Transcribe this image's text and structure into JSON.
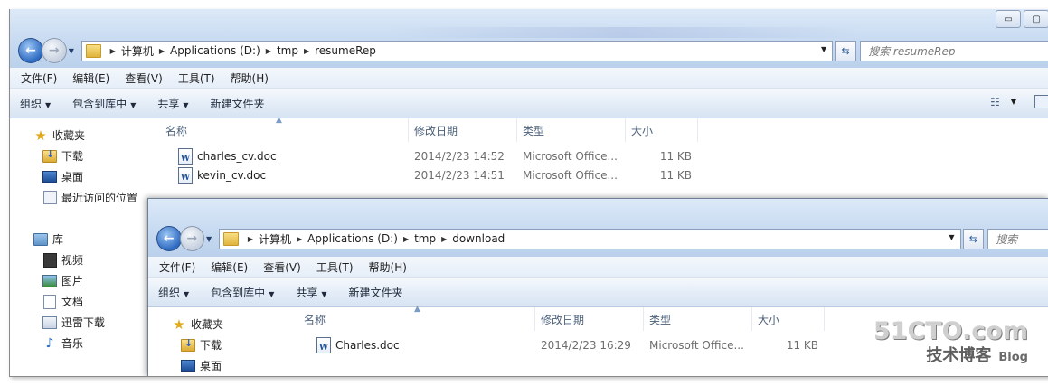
{
  "window1": {
    "caption_buttons": [
      "▭",
      "▢"
    ],
    "address": {
      "segments": [
        "计算机",
        "Applications (D:)",
        "tmp",
        "resumeRep"
      ]
    },
    "search_placeholder": "搜索 resumeRep",
    "menu": [
      "文件(F)",
      "编辑(E)",
      "查看(V)",
      "工具(T)",
      "帮助(H)"
    ],
    "commands": {
      "organize": "组织",
      "include_library": "包含到库中",
      "share": "共享",
      "new_folder": "新建文件夹"
    },
    "nav": {
      "favorites": "收藏夹",
      "downloads": "下载",
      "desktop": "桌面",
      "recent": "最近访问的位置",
      "libraries": "库",
      "videos": "视频",
      "pictures": "图片",
      "documents": "文档",
      "thunder": "迅雷下载",
      "music": "音乐"
    },
    "columns": [
      "名称",
      "修改日期",
      "类型",
      "大小"
    ],
    "files": [
      {
        "name": "charles_cv.doc",
        "modified": "2014/2/23 14:52",
        "type": "Microsoft Office...",
        "size": "11 KB"
      },
      {
        "name": "kevin_cv.doc",
        "modified": "2014/2/23 14:51",
        "type": "Microsoft Office...",
        "size": "11 KB"
      }
    ]
  },
  "window2": {
    "address": {
      "segments": [
        "计算机",
        "Applications (D:)",
        "tmp",
        "download"
      ]
    },
    "search_placeholder": "搜索",
    "menu": [
      "文件(F)",
      "编辑(E)",
      "查看(V)",
      "工具(T)",
      "帮助(H)"
    ],
    "commands": {
      "organize": "组织",
      "include_library": "包含到库中",
      "share": "共享",
      "new_folder": "新建文件夹"
    },
    "nav": {
      "favorites": "收藏夹",
      "downloads": "下载",
      "desktop": "桌面"
    },
    "columns": [
      "名称",
      "修改日期",
      "类型",
      "大小"
    ],
    "files": [
      {
        "name": "Charles.doc",
        "modified": "2014/2/23 16:29",
        "type": "Microsoft Office...",
        "size": "11 KB"
      }
    ]
  },
  "watermark": {
    "main": "51CTO.com",
    "sub": "技术博客",
    "blog": "Blog"
  }
}
